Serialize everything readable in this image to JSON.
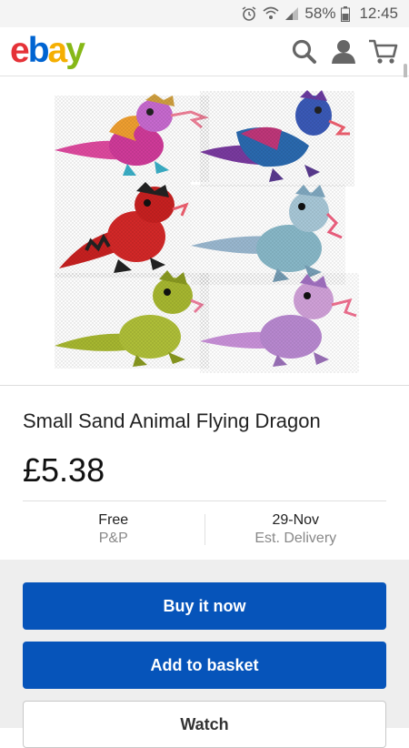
{
  "status_bar": {
    "battery": "58%",
    "time": "12:45"
  },
  "header": {
    "logo_letters": [
      "e",
      "b",
      "a",
      "y"
    ],
    "logo_colors": [
      "#e53238",
      "#0064d2",
      "#f5af02",
      "#86b817"
    ],
    "icons": [
      "search-icon",
      "account-icon",
      "cart-icon"
    ]
  },
  "product": {
    "title": "Small Sand Animal Flying Dragon",
    "price": "£5.38"
  },
  "shipping": {
    "cost": "Free",
    "cost_label": "P&P",
    "delivery_date": "29-Nov",
    "delivery_label": "Est. Delivery"
  },
  "actions": {
    "buy_now": "Buy it now",
    "add_to_basket": "Add to basket",
    "watch": "Watch"
  },
  "colors": {
    "primary_button": "#0654ba",
    "actions_background": "#eeeeee"
  }
}
